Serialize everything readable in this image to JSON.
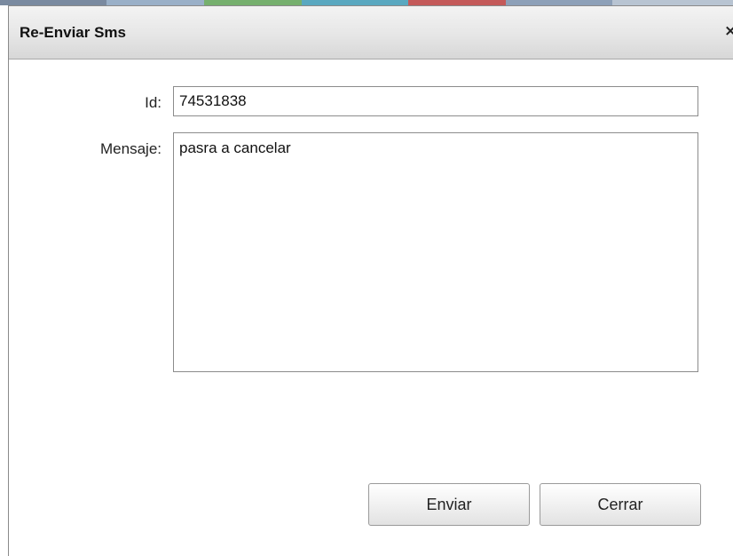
{
  "dialog": {
    "title": "Re-Enviar Sms",
    "close_glyph": "×"
  },
  "form": {
    "id_label": "Id:",
    "id_value": "74531838",
    "message_label": "Mensaje:",
    "message_value": "pasra a cancelar"
  },
  "buttons": {
    "send_label": "Enviar",
    "close_label": "Cerrar"
  },
  "colors": {
    "titlebar_top": "#f3f3f3",
    "titlebar_bottom": "#d7d7d7",
    "border": "#8c8c8c",
    "background_strip": [
      "#7a8aa0",
      "#9ab0c8",
      "#76b06e",
      "#5aa8c0",
      "#c45a5a",
      "#8da0b8",
      "#b8c4d2"
    ]
  },
  "icons": {
    "close": "close-icon"
  }
}
